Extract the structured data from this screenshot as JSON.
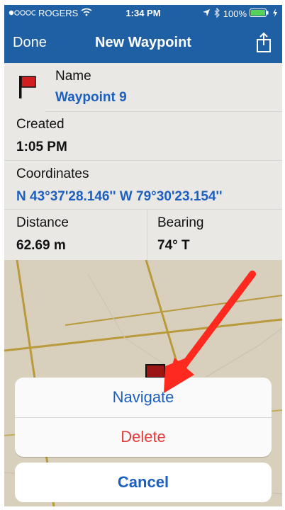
{
  "status": {
    "carrier": "ROGERS",
    "time": "1:34 PM",
    "battery": "100%",
    "icons": [
      "signal-dots-icon",
      "wifi-icon",
      "location-icon",
      "bluetooth-icon",
      "battery-icon",
      "charging-icon"
    ]
  },
  "nav": {
    "left": "Done",
    "title": "New Waypoint",
    "right_icon": "share-icon"
  },
  "waypoint": {
    "name_label": "Name",
    "name_value": "Waypoint 9",
    "flag_icon": "red-flag-icon"
  },
  "created": {
    "label": "Created",
    "value": "1:05 PM"
  },
  "coordinates": {
    "label": "Coordinates",
    "value": "N 43°37'28.146'' W 79°30'23.154''"
  },
  "distance": {
    "label": "Distance",
    "value": "62.69 m"
  },
  "bearing": {
    "label": "Bearing",
    "value": "74° T"
  },
  "action_sheet": {
    "navigate": "Navigate",
    "delete": "Delete",
    "cancel": "Cancel"
  },
  "colors": {
    "blue": "#1d5fbf",
    "red": "#e53b3b",
    "navbar": "#1f5fa4",
    "annotation_arrow": "#ff2a1f"
  }
}
